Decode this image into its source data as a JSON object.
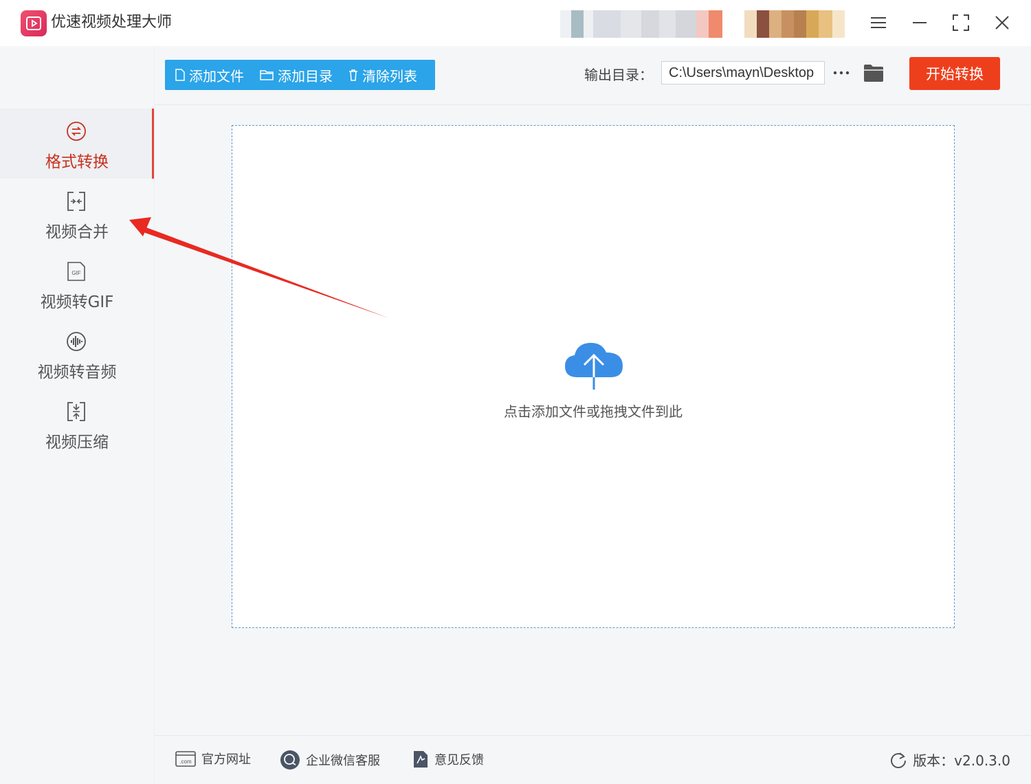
{
  "app": {
    "title": "优速视频处理大师"
  },
  "colors": {
    "accent": "#2ba4e9",
    "start": "#ee3f1d",
    "active": "#c8301f",
    "cloud": "#3a8ee6",
    "arrow": "#e82a22"
  },
  "sidebar": {
    "items": [
      {
        "label": "格式转换",
        "icon": "format-convert-icon",
        "active": true
      },
      {
        "label": "视频合并",
        "icon": "merge-icon"
      },
      {
        "label": "视频转GIF",
        "icon": "gif-icon"
      },
      {
        "label": "视频转音频",
        "icon": "audio-icon"
      },
      {
        "label": "视频压缩",
        "icon": "compress-icon"
      }
    ]
  },
  "toolbar": {
    "add_file": "添加文件",
    "add_dir": "添加目录",
    "clear_list": "清除列表",
    "output_label": "输出目录：",
    "output_path": "C:\\Users\\mayn\\Desktop",
    "start": "开始转换"
  },
  "dropzone": {
    "hint": "点击添加文件或拖拽文件到此"
  },
  "footer": {
    "website": "官方网址",
    "wechat": "企业微信客服",
    "feedback": "意见反馈",
    "version": "版本：v2.0.3.0"
  }
}
